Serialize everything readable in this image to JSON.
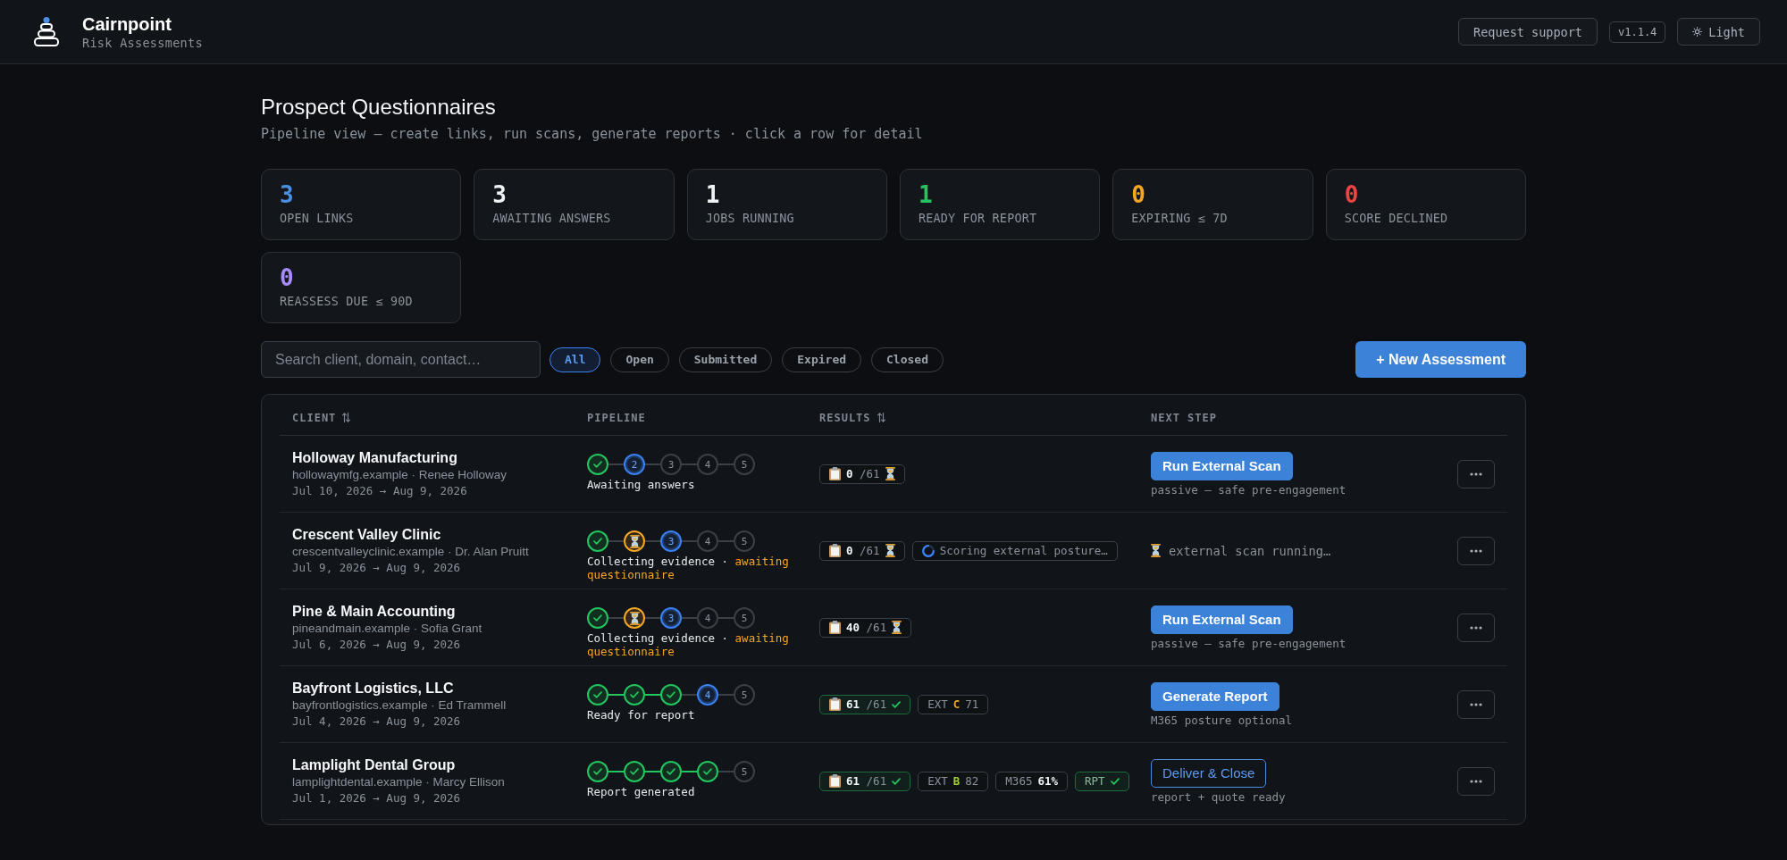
{
  "app": {
    "name": "Cairnpoint",
    "subtitle": "Risk Assessments",
    "actions": [
      {
        "kind": "support",
        "label": "Request support"
      },
      {
        "kind": "version",
        "label": "v1.1.4"
      },
      {
        "kind": "theme",
        "label": "Light"
      }
    ]
  },
  "page": {
    "title": "Prospect Questionnaires",
    "subtitle": "Pipeline view — create links, run scans, generate reports · click a row for detail"
  },
  "stats": [
    {
      "value": "3",
      "label": "OPEN LINKS",
      "color": "#4a90e2"
    },
    {
      "value": "3",
      "label": "AWAITING ANSWERS",
      "color": "#f0f2f4"
    },
    {
      "value": "1",
      "label": "JOBS RUNNING",
      "color": "#f0f2f4"
    },
    {
      "value": "1",
      "label": "READY FOR REPORT",
      "color": "#22c55e"
    },
    {
      "value": "0",
      "label": "EXPIRING ≤ 7D",
      "color": "#f5a623"
    },
    {
      "value": "0",
      "label": "SCORE DECLINED",
      "color": "#ef4444"
    },
    {
      "value": "0",
      "label": "REASSESS DUE ≤ 90D",
      "color": "#a78bfa"
    }
  ],
  "toolbar": {
    "search": {
      "placeholder": "Search client, domain, contact…"
    },
    "filters": [
      {
        "label": "All",
        "selected": true
      },
      {
        "label": "Open",
        "selected": false
      },
      {
        "label": "Submitted",
        "selected": false
      },
      {
        "label": "Expired",
        "selected": false
      },
      {
        "label": "Closed",
        "selected": false
      }
    ],
    "new_button": "+ New Assessment"
  },
  "table": {
    "columns": [
      {
        "label": "CLIENT",
        "sortable": true
      },
      {
        "label": "PIPELINE",
        "sortable": false
      },
      {
        "label": "RESULTS",
        "sortable": true
      },
      {
        "label": "NEXT STEP",
        "sortable": false
      }
    ],
    "rows": [
      {
        "client": "Holloway Manufacturing",
        "contact": "hollowaymfg.example · Renee Holloway",
        "dates": "Jul 10, 2026 → Aug 9, 2026",
        "pipeline": {
          "steps": [
            {
              "kind": "done"
            },
            {
              "label": "2",
              "kind": "current"
            },
            {
              "label": "3",
              "kind": "pending"
            },
            {
              "label": "4",
              "kind": "pending"
            },
            {
              "label": "5",
              "kind": "pending"
            }
          ],
          "status": "Awaiting answers"
        },
        "results": [
          {
            "kind": "questionnaire",
            "answered": "0",
            "total": "/61",
            "complete": false
          }
        ],
        "next_step": {
          "kind": "primary",
          "label": "Run External Scan",
          "caption": "passive — safe pre-engagement"
        }
      },
      {
        "client": "Crescent Valley Clinic",
        "contact": "crescentvalleyclinic.example · Dr. Alan Pruitt",
        "dates": "Jul 9, 2026 → Aug 9, 2026",
        "pipeline": {
          "steps": [
            {
              "kind": "done"
            },
            {
              "kind": "waiting"
            },
            {
              "label": "3",
              "kind": "current"
            },
            {
              "label": "4",
              "kind": "pending"
            },
            {
              "label": "5",
              "kind": "pending"
            }
          ],
          "status": "Collecting evidence ·",
          "note": "awaiting questionnaire"
        },
        "results": [
          {
            "kind": "questionnaire",
            "answered": "0",
            "total": "/61",
            "complete": false
          },
          {
            "kind": "job",
            "label": "Scoring external posture…"
          }
        ],
        "next_step": {
          "kind": "running",
          "label": "external scan running…"
        }
      },
      {
        "client": "Pine & Main Accounting",
        "contact": "pineandmain.example · Sofia Grant",
        "dates": "Jul 6, 2026 → Aug 9, 2026",
        "pipeline": {
          "steps": [
            {
              "kind": "done"
            },
            {
              "kind": "waiting"
            },
            {
              "label": "3",
              "kind": "current"
            },
            {
              "label": "4",
              "kind": "pending"
            },
            {
              "label": "5",
              "kind": "pending"
            }
          ],
          "status": "Collecting evidence ·",
          "note": "awaiting questionnaire"
        },
        "results": [
          {
            "kind": "questionnaire",
            "answered": "40",
            "total": "/61",
            "complete": false
          }
        ],
        "next_step": {
          "kind": "primary",
          "label": "Run External Scan",
          "caption": "passive — safe pre-engagement"
        }
      },
      {
        "client": "Bayfront Logistics, LLC",
        "contact": "bayfrontlogistics.example · Ed Trammell",
        "dates": "Jul 4, 2026 → Aug 9, 2026",
        "pipeline": {
          "steps": [
            {
              "kind": "done"
            },
            {
              "kind": "done"
            },
            {
              "kind": "done"
            },
            {
              "label": "4",
              "kind": "current"
            },
            {
              "label": "5",
              "kind": "pending"
            }
          ],
          "status": "Ready for report"
        },
        "results": [
          {
            "kind": "questionnaire",
            "answered": "61",
            "total": "/61",
            "complete": true
          },
          {
            "kind": "score",
            "label": "EXT",
            "grade": "C",
            "score": "71",
            "color": "#f5a623"
          }
        ],
        "next_step": {
          "kind": "primary",
          "label": "Generate Report",
          "caption": "M365 posture optional"
        }
      },
      {
        "client": "Lamplight Dental Group",
        "contact": "lamplightdental.example · Marcy Ellison",
        "dates": "Jul 1, 2026 → Aug 9, 2026",
        "pipeline": {
          "steps": [
            {
              "kind": "done"
            },
            {
              "kind": "done"
            },
            {
              "kind": "done"
            },
            {
              "kind": "done"
            },
            {
              "label": "5",
              "kind": "pending"
            }
          ],
          "status": "Report generated"
        },
        "results": [
          {
            "kind": "questionnaire",
            "answered": "61",
            "total": "/61",
            "complete": true
          },
          {
            "kind": "score",
            "label": "EXT",
            "grade": "B",
            "score": "82",
            "color": "#a3cc3a"
          },
          {
            "kind": "m365",
            "label": "M365",
            "value": "61%"
          },
          {
            "kind": "report",
            "label": "RPT",
            "complete": true
          }
        ],
        "next_step": {
          "kind": "outline",
          "label": "Deliver & Close",
          "caption": "report + quote ready"
        }
      }
    ]
  }
}
